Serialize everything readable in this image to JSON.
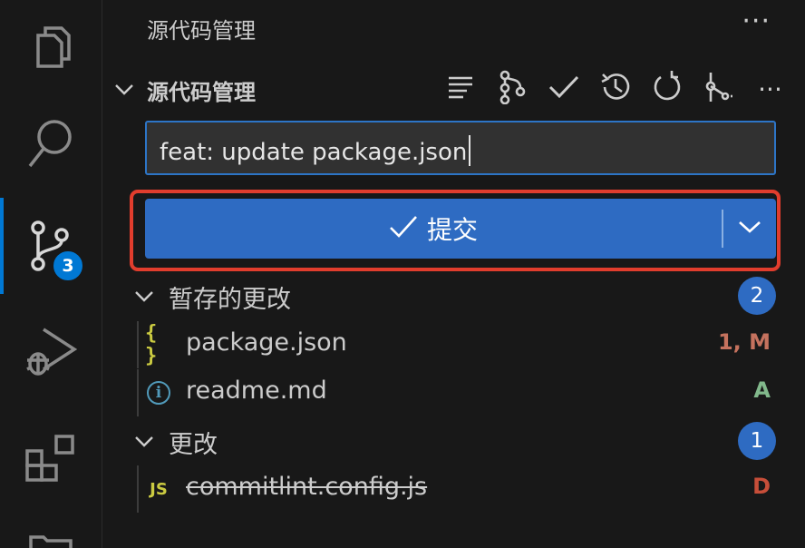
{
  "activity_bar": {
    "items": [
      {
        "name": "explorer",
        "icon": "files-icon"
      },
      {
        "name": "search",
        "icon": "search-icon"
      },
      {
        "name": "source-control",
        "icon": "source-control-icon",
        "badge": "3",
        "active": true
      },
      {
        "name": "run-debug",
        "icon": "run-debug-icon"
      },
      {
        "name": "extensions",
        "icon": "extensions-icon"
      }
    ]
  },
  "sidebar": {
    "view_title": "源代码管理",
    "more_label": "···",
    "section": {
      "title": "源代码管理",
      "toolbar_icons": [
        "view-as-tree-icon",
        "graph-icon",
        "check-icon",
        "history-icon",
        "refresh-icon",
        "branch-icon",
        "more-icon"
      ],
      "toolbar_more_label": "···"
    },
    "commit_input": {
      "value": "feat: update package.json"
    },
    "commit_button": {
      "label": "提交"
    },
    "groups": [
      {
        "title": "暂存的更改",
        "count": "2",
        "files": [
          {
            "name": "package.json",
            "icon": "json-icon",
            "icon_glyph": "{ }",
            "status": "1, M",
            "status_color": "#c5725e",
            "deleted": false
          },
          {
            "name": "readme.md",
            "icon": "info-icon",
            "icon_glyph": "i",
            "status": "A",
            "status_color": "#81b88b",
            "deleted": false
          }
        ]
      },
      {
        "title": "更改",
        "count": "1",
        "files": [
          {
            "name": "commitlint.config.js",
            "icon": "javascript-icon",
            "icon_glyph": "JS",
            "status": "D",
            "status_color": "#c74e39",
            "deleted": true
          }
        ]
      }
    ]
  },
  "colors": {
    "accent": "#2e6bc2",
    "highlight_border": "#e13d2d",
    "background": "#181818"
  }
}
